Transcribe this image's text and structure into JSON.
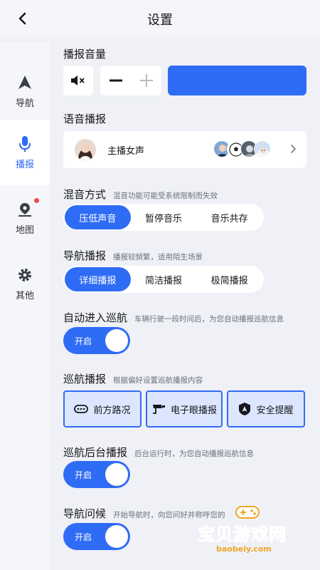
{
  "header": {
    "title": "设置"
  },
  "sidebar": {
    "items": [
      {
        "label": "导航",
        "icon": "navigation-arrow-icon"
      },
      {
        "label": "播报",
        "icon": "microphone-icon",
        "active": true
      },
      {
        "label": "地图",
        "icon": "map-pin-icon",
        "has_dot": true
      },
      {
        "label": "其他",
        "icon": "gear-icon"
      }
    ]
  },
  "volume": {
    "title": "播报音量",
    "mute_icon": "speaker-mute-icon",
    "minus": "−",
    "plus": "+",
    "level": 1.0
  },
  "voice": {
    "title": "语音播报",
    "current": "主播女声"
  },
  "mix": {
    "title": "混音方式",
    "desc": "混音功能可能受系统限制而失效",
    "options": [
      "压低声音",
      "暂停音乐",
      "音乐共存"
    ],
    "selected": 0
  },
  "nav_broadcast": {
    "title": "导航播报",
    "desc": "播报较频繁，适用陌生场景",
    "options": [
      "详细播报",
      "简洁播报",
      "极简播报"
    ],
    "selected": 0
  },
  "auto_cruise": {
    "title": "自动进入巡航",
    "desc": "车辆行驶一段时间后，为您自动播报巡航信息",
    "toggle_label": "开启",
    "on": true
  },
  "cruise_broadcast": {
    "title": "巡航播报",
    "desc": "根据偏好设置巡航播报内容",
    "chips": [
      {
        "label": "前方路况",
        "icon": "traffic-icon",
        "selected": true
      },
      {
        "label": "电子眼播报",
        "icon": "camera-icon",
        "selected": true
      },
      {
        "label": "安全提醒",
        "icon": "shield-icon",
        "selected": true
      }
    ]
  },
  "cruise_background": {
    "title": "巡航后台播报",
    "desc": "后台运行时，为您自动播报巡航信息",
    "toggle_label": "开启",
    "on": true
  },
  "nav_greeting": {
    "title": "导航问候",
    "desc": "开始导航时，向您问好并称呼您的",
    "toggle_label": "开启",
    "on": true
  },
  "watermark": {
    "text": "宝贝游戏网",
    "url": "baobeiy.com"
  },
  "colors": {
    "accent": "#2f6cf5",
    "chip_bg": "#dce7ff",
    "background": "#eff1f7"
  }
}
